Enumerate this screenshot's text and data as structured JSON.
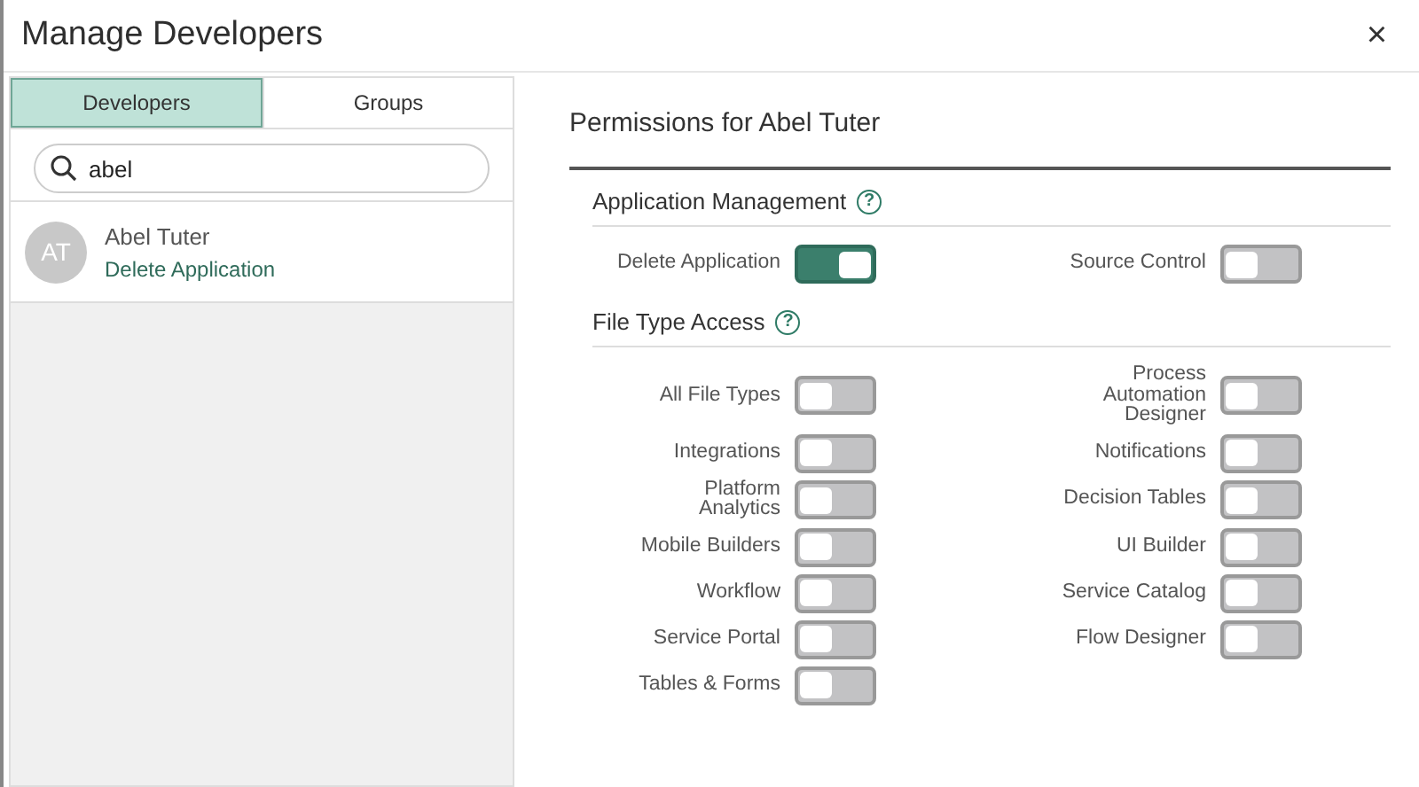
{
  "window": {
    "title": "Manage Developers",
    "close": "×"
  },
  "tabs": [
    {
      "label": "Developers",
      "selected": true
    },
    {
      "label": "Groups",
      "selected": false
    }
  ],
  "search": {
    "value": "abel"
  },
  "developers": [
    {
      "initials": "AT",
      "name": "Abel Tuter",
      "permission": "Delete Application",
      "selected": false
    }
  ],
  "permissions": {
    "title": "Permissions for Abel Tuter",
    "sections": [
      {
        "title": "Application Management",
        "help": "?",
        "toggles": [
          {
            "label": "Delete Application",
            "on": true
          },
          {
            "label": "Source Control",
            "on": false
          }
        ]
      },
      {
        "title": "File Type Access",
        "help": "?",
        "toggles": [
          {
            "label": "All File Types",
            "on": false
          },
          {
            "label": "Integrations",
            "on": false
          },
          {
            "label": "Platform Analytics",
            "on": false
          },
          {
            "label": "Mobile Builders",
            "on": false
          },
          {
            "label": "Workflow",
            "on": false
          },
          {
            "label": "Service Portal",
            "on": false
          },
          {
            "label": "Tables & Forms",
            "on": false
          },
          {
            "label": "Process Automation Designer",
            "on": false
          },
          {
            "label": "Notifications",
            "on": false
          },
          {
            "label": "Decision Tables",
            "on": false
          },
          {
            "label": "UI Builder",
            "on": false
          },
          {
            "label": "Service Catalog",
            "on": false
          },
          {
            "label": "Flow Designer",
            "on": false
          }
        ]
      }
    ]
  }
}
